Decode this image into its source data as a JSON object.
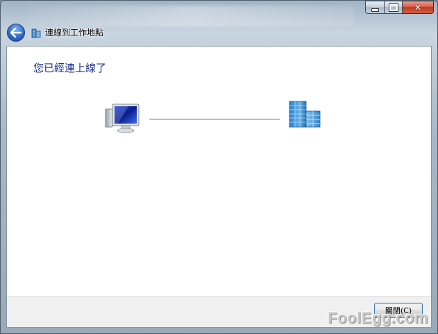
{
  "window": {
    "title": "連線到工作地點",
    "close_glyph": "✕"
  },
  "main": {
    "heading": "您已經連上線了"
  },
  "footer": {
    "close_button_label": "關閉(C)"
  },
  "watermark": "FoolEgg.com",
  "icons": [
    "back-arrow-icon",
    "workplace-network-icon",
    "computer-icon",
    "server-icon"
  ],
  "colors": {
    "heading": "#1e3287",
    "accent": "#2f6cc9",
    "close": "#c0391e"
  }
}
